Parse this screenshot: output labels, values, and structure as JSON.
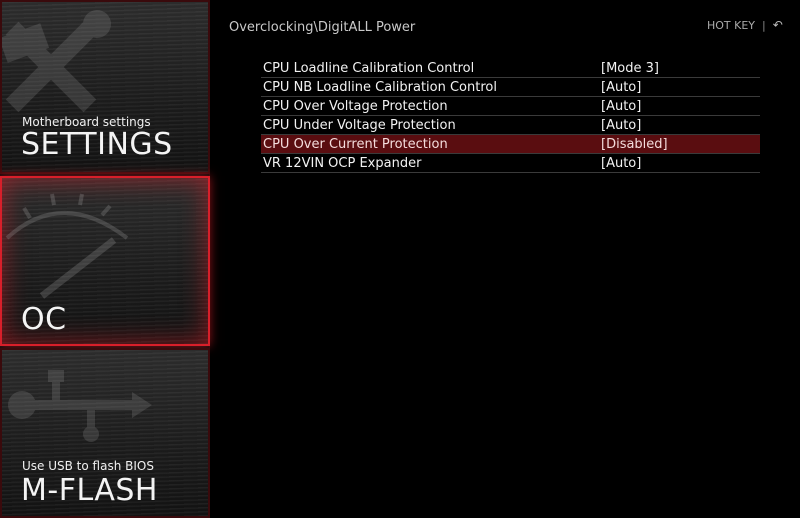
{
  "sidebar": {
    "settings": {
      "subtitle": "Motherboard settings",
      "title": "SETTINGS",
      "icon": "tools-icon"
    },
    "oc": {
      "title": "OC",
      "icon": "gauge-icon"
    },
    "mflash": {
      "subtitle": "Use USB to flash BIOS",
      "title": "M-FLASH",
      "icon": "usb-icon"
    }
  },
  "header": {
    "breadcrumb": "Overclocking\\DigitALL Power",
    "hotkey_label": "HOT KEY",
    "separator": "|",
    "back_icon": "back-arrow-icon"
  },
  "settings_list": [
    {
      "label": "CPU Loadline Calibration Control",
      "value": "[Mode 3]"
    },
    {
      "label": "CPU NB Loadline Calibration Control",
      "value": "[Auto]"
    },
    {
      "label": "CPU Over Voltage Protection",
      "value": "[Auto]"
    },
    {
      "label": "CPU Under Voltage Protection",
      "value": "[Auto]"
    },
    {
      "label": "CPU Over Current Protection",
      "value": "[Disabled]",
      "selected": true
    },
    {
      "label": "VR 12VIN OCP Expander",
      "value": "[Auto]"
    }
  ],
  "colors": {
    "accent": "#d81f2a",
    "selected_row": "#5a0d10"
  }
}
